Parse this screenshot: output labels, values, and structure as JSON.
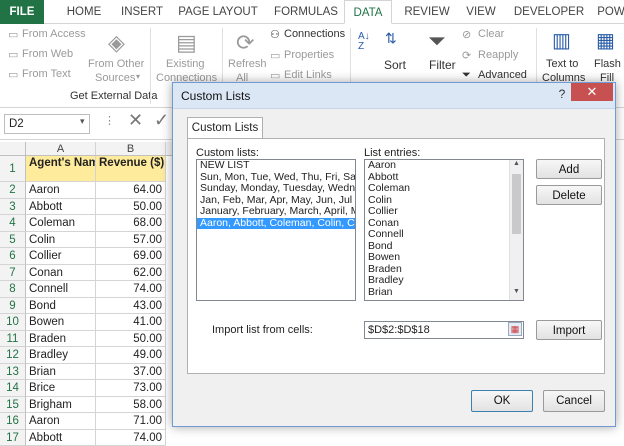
{
  "ribbon_tabs": {
    "file": "FILE",
    "home": "HOME",
    "insert": "INSERT",
    "page_layout": "PAGE LAYOUT",
    "formulas": "FORMULAS",
    "data": "DATA",
    "review": "REVIEW",
    "view": "VIEW",
    "developer": "DEVELOPER",
    "power": "POW"
  },
  "ribbon": {
    "from_access": "From Access",
    "from_web": "From Web",
    "from_text": "From Text",
    "from_other": "From Other",
    "sources": "Sources",
    "existing": "Existing",
    "connections_btn": "Connections",
    "refresh": "Refresh",
    "all": "All",
    "connections": "Connections",
    "properties": "Properties",
    "edit_links": "Edit Links",
    "sort": "Sort",
    "filter": "Filter",
    "clear": "Clear",
    "reapply": "Reapply",
    "advanced": "Advanced",
    "text_to": "Text to",
    "columns": "Columns",
    "flash": "Flash",
    "fill": "Fill",
    "group_get_external": "Get External Data"
  },
  "formula_bar": {
    "name_box": "D2"
  },
  "sheet": {
    "col_a": "A",
    "col_b": "B",
    "header_a": "Agent's Name",
    "header_b": "Revenue ($)",
    "rows": [
      {
        "n": "1"
      },
      {
        "n": "2",
        "a": "Aaron",
        "b": "64.00"
      },
      {
        "n": "3",
        "a": "Abbott",
        "b": "50.00"
      },
      {
        "n": "4",
        "a": "Coleman",
        "b": "68.00"
      },
      {
        "n": "5",
        "a": "Colin",
        "b": "57.00"
      },
      {
        "n": "6",
        "a": "Collier",
        "b": "69.00"
      },
      {
        "n": "7",
        "a": "Conan",
        "b": "62.00"
      },
      {
        "n": "8",
        "a": "Connell",
        "b": "74.00"
      },
      {
        "n": "9",
        "a": "Bond",
        "b": "43.00"
      },
      {
        "n": "10",
        "a": "Bowen",
        "b": "41.00"
      },
      {
        "n": "11",
        "a": "Braden",
        "b": "50.00"
      },
      {
        "n": "12",
        "a": "Bradley",
        "b": "49.00"
      },
      {
        "n": "13",
        "a": "Brian",
        "b": "37.00"
      },
      {
        "n": "14",
        "a": "Brice",
        "b": "73.00"
      },
      {
        "n": "15",
        "a": "Brigham",
        "b": "58.00"
      },
      {
        "n": "16",
        "a": "Aaron",
        "b": "71.00"
      },
      {
        "n": "17",
        "a": "Abbott",
        "b": "74.00"
      }
    ]
  },
  "dialog": {
    "title": "Custom Lists",
    "tab": "Custom Lists",
    "custom_lists_label": "Custom lists:",
    "custom_lists": [
      "NEW LIST",
      "Sun, Mon, Tue, Wed, Thu, Fri, Sat",
      "Sunday, Monday, Tuesday, Wednesday",
      "Jan, Feb, Mar, Apr, May, Jun, Jul",
      "January, February, March, April, May",
      "Aaron, Abbott, Coleman, Colin, Collier"
    ],
    "selected_index": 5,
    "list_entries_label": "List entries:",
    "list_entries": [
      "Aaron",
      "Abbott",
      "Coleman",
      "Colin",
      "Collier",
      "Conan",
      "Connell",
      "Bond",
      "Bowen",
      "Braden",
      "Bradley",
      "Brian"
    ],
    "add": "Add",
    "delete": "Delete",
    "import_label": "Import list from cells:",
    "import_value": "$D$2:$D$18",
    "import": "Import",
    "ok": "OK",
    "cancel": "Cancel"
  }
}
